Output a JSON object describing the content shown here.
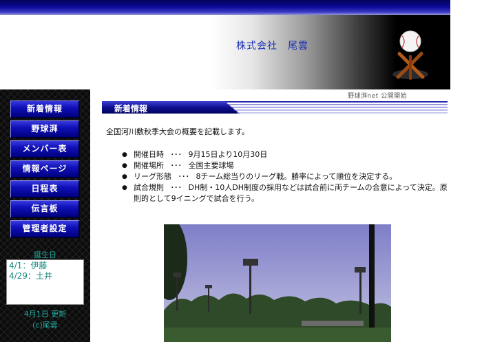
{
  "header": {
    "company": "株式会社　尾雲"
  },
  "nav": {
    "items": [
      "新着情報",
      "野球湃",
      "メンバー表",
      "情報ページ",
      "日程表",
      "伝言板",
      "管理者設定"
    ]
  },
  "birthday": {
    "title": "誕生日",
    "entries": [
      "4/1：伊藤",
      "4/29：土井"
    ]
  },
  "footer_side": {
    "update": "4月1日 更新",
    "copyright": "(c)尾雲"
  },
  "ticker": "野球湃net 公開開始",
  "section": {
    "title": "新着情報"
  },
  "content": {
    "intro": "全国河川敷秋季大会の概要を記載します。",
    "items": [
      {
        "label": "開催日時",
        "sep": "･･･",
        "text": "9月15日より10月30日"
      },
      {
        "label": "開催場所",
        "sep": "･･･",
        "text": "全国主要球場"
      },
      {
        "label": "リーグ形態",
        "sep": "･･･",
        "text": "8チーム総当りのリーグ戦。勝率によって順位を決定する。"
      },
      {
        "label": "試合規則",
        "sep": "･･･",
        "text": "DH制・10人DH制度の採用などは試合前に両チームの合意によって決定。原則的として9イニングで試合を行う。"
      }
    ]
  },
  "colors": {
    "nav_bg": "#1010b8",
    "accent": "#000080",
    "teal_text": "#22aaa0",
    "company_text": "#1a2fb4"
  },
  "icons": {
    "logo": "baseball-on-bat-stand-icon",
    "bullet": "disc-bullet-icon"
  }
}
